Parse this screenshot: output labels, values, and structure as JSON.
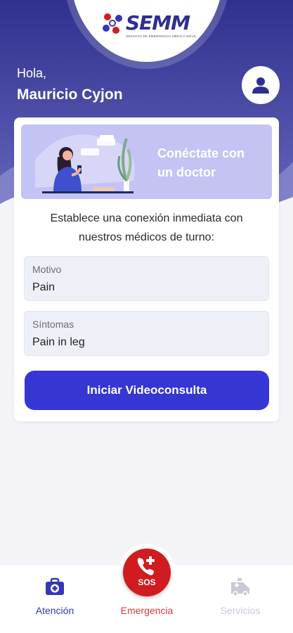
{
  "brand": {
    "name": "SEMM",
    "subtitle": "SERVICIO DE EMERGENCIA MÉDICA MÓVIL",
    "colors": {
      "primary": "#3536d4",
      "header": "#3b3c9e",
      "emergency": "#d01c20"
    }
  },
  "greeting": {
    "hello": "Hola,",
    "user_name": "Mauricio Cyjon"
  },
  "profile": {
    "icon": "user-icon"
  },
  "consult_card": {
    "banner_title": "Conéctate con un doctor",
    "description": "Establece una conexión inmediata con nuestros médicos de turno:",
    "fields": [
      {
        "label": "Motivo",
        "value": "Pain"
      },
      {
        "label": "Síntomas",
        "value": "Pain in leg"
      }
    ],
    "button_label": "Iniciar Videoconsulta"
  },
  "bottom_nav": {
    "items": [
      {
        "label": "Atención",
        "icon": "medical-kit-icon",
        "active": true
      },
      {
        "label": "Emergencia",
        "icon": "sos-phone-icon",
        "active": false
      },
      {
        "label": "Servicios",
        "icon": "ambulance-icon",
        "active": false
      }
    ],
    "sos_label": "SOS"
  }
}
